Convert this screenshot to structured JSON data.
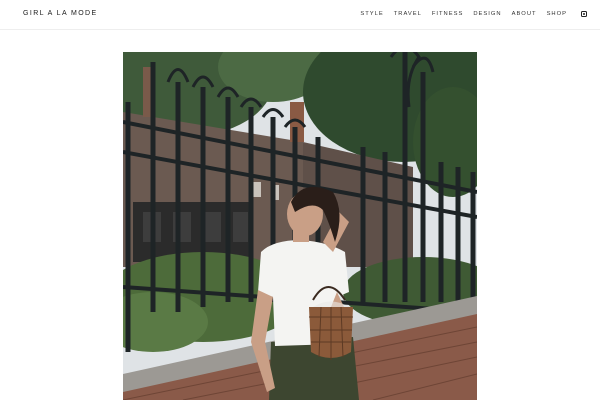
{
  "site": {
    "logo": "GIRL A LA MODE"
  },
  "nav": {
    "items": [
      "STYLE",
      "TRAVEL",
      "FITNESS",
      "DESIGN",
      "ABOUT",
      "SHOP"
    ],
    "social_icon": "instagram-icon"
  },
  "hero": {
    "image_subject": "photo"
  }
}
